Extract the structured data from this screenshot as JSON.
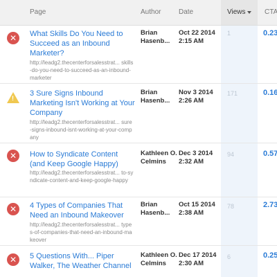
{
  "header": {
    "page": "Page",
    "author": "Author",
    "date": "Date",
    "views": "Views",
    "cta": "CTA"
  },
  "rows": [
    {
      "status": "error",
      "title": "What Skills Do You Need to Succeed as an Inbound Marketer?",
      "url": "http://leadg2.thecenterforsalesstrat... skills-do-you-need-to-succeed-as-an-inbound-marketer",
      "author": "Brian Hasenb...",
      "date_line1": "Oct 22 2014",
      "date_line2": "2:15 AM",
      "views": "1",
      "cta": "0.23"
    },
    {
      "status": "warning",
      "title": "3 Sure Signs Inbound Marketing Isn't Working at Your Company",
      "url": "http://leadg2.thecenterforsalesstrat... sure-signs-inbound-isnt-working-at-your-company",
      "author": "Brian Hasenb...",
      "date_line1": "Nov 3 2014",
      "date_line2": "2:26 AM",
      "views": "171",
      "cta": "0.16"
    },
    {
      "status": "error",
      "title": "How to Syndicate Content (and Keep Google Happy)",
      "url": "http://leadg2.thecenterforsalesstrat... to-syndicate-content-and-keep-google-happy",
      "author": "Kathleen O. Celmins",
      "date_line1": "Dec 3 2014",
      "date_line2": "2:32 AM",
      "views": "94",
      "cta": "0.57"
    },
    {
      "status": "error",
      "title": "4 Types of Companies That Need an Inbound Makeover",
      "url": "http://leadg2.thecenterforsalesstrat... types-of-companies-that-need-an-inbound-makeover",
      "author": "Brian Hasenb...",
      "date_line1": "Oct 15 2014",
      "date_line2": "2:38 AM",
      "views": "78",
      "cta": "2.73"
    },
    {
      "status": "error",
      "title": "5 Questions With... Piper Walker, The Weather Channel",
      "url": "",
      "author": "Kathleen O. Celmins",
      "date_line1": "Dec 17 2014",
      "date_line2": "2:30 AM",
      "views": "6",
      "cta": "0.25"
    }
  ]
}
